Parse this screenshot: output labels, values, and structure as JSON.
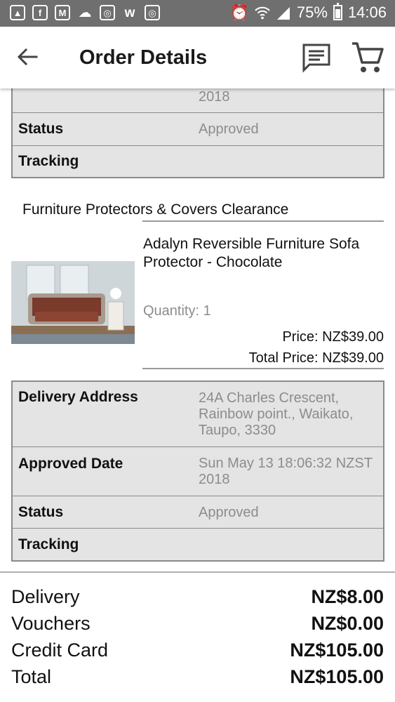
{
  "status_bar": {
    "notification_icons": [
      "image-icon",
      "facebook-icon",
      "gmail-icon",
      "weather-icon",
      "instagram-icon",
      "wish-icon",
      "instagram-icon"
    ],
    "battery_percent": "75%",
    "time": "14:06"
  },
  "app_bar": {
    "title": "Order Details"
  },
  "top_table": {
    "partial_date_tail": "2018",
    "status_label": "Status",
    "status_value": "Approved",
    "tracking_label": "Tracking"
  },
  "store": {
    "name": "Furniture Protectors & Covers Clearance"
  },
  "product": {
    "name": "Adalyn Reversible Furniture Sofa Protector - Chocolate",
    "quantity_label": "Quantity:",
    "quantity": "1",
    "price_label": "Price:",
    "price": "NZ$39.00",
    "total_label": "Total Price:",
    "total": "NZ$39.00"
  },
  "details": {
    "delivery_address_label": "Delivery Address",
    "delivery_address": "24A Charles Crescent, Rainbow point., Waikato, Taupo, 3330",
    "approved_date_label": "Approved Date",
    "approved_date": "Sun May 13 18:06:32 NZST 2018",
    "status_label": "Status",
    "status_value": "Approved",
    "tracking_label": "Tracking"
  },
  "summary": {
    "delivery_label": "Delivery",
    "delivery_value": "NZ$8.00",
    "vouchers_label": "Vouchers",
    "vouchers_value": "NZ$0.00",
    "credit_label": "Credit Card",
    "credit_value": "NZ$105.00",
    "total_label": "Total",
    "total_value": "NZ$105.00"
  }
}
